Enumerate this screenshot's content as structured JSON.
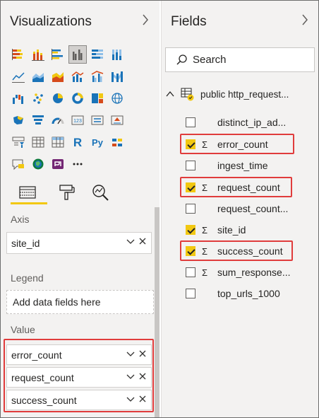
{
  "visualizations": {
    "title": "Visualizations",
    "collapse_icon": "chevron-right-icon",
    "gallery": [
      "stacked-bar-chart-icon",
      "stacked-column-chart-icon",
      "clustered-bar-chart-icon",
      "clustered-column-chart-icon",
      "100-stacked-bar-chart-icon",
      "100-stacked-column-chart-icon",
      "",
      "line-chart-icon",
      "area-chart-icon",
      "stacked-area-chart-icon",
      "line-and-stacked-column-icon",
      "line-and-clustered-column-icon",
      "ribbon-chart-icon",
      "",
      "waterfall-chart-icon",
      "scatter-chart-icon",
      "pie-chart-icon",
      "donut-chart-icon",
      "treemap-icon",
      "map-icon",
      "",
      "filled-map-icon",
      "funnel-icon",
      "gauge-icon",
      "card-icon",
      "multi-row-card-icon",
      "kpi-icon",
      "",
      "slicer-icon",
      "table-icon",
      "matrix-icon",
      "r-visual-icon",
      "python-visual-icon",
      "key-influencers-icon",
      "",
      "qa-icon",
      "arcgis-map-icon",
      "power-apps-icon",
      "more-icon"
    ],
    "tools": [
      "fields-tab-icon",
      "format-paint-icon",
      "analytics-icon"
    ],
    "axis": {
      "label": "Axis",
      "field": "site_id"
    },
    "legend": {
      "label": "Legend",
      "placeholder": "Add data fields here"
    },
    "value": {
      "label": "Value",
      "fields": [
        "error_count",
        "request_count",
        "success_count"
      ]
    }
  },
  "fields": {
    "title": "Fields",
    "collapse_icon": "chevron-right-icon",
    "search_placeholder": "Search",
    "table_name": "public http_request...",
    "items": [
      {
        "name": "distinct_ip_ad...",
        "checked": false,
        "sigma": false
      },
      {
        "name": "error_count",
        "checked": true,
        "sigma": true
      },
      {
        "name": "ingest_time",
        "checked": false,
        "sigma": false
      },
      {
        "name": "request_count",
        "checked": true,
        "sigma": true
      },
      {
        "name": "request_count...",
        "checked": false,
        "sigma": false
      },
      {
        "name": "site_id",
        "checked": true,
        "sigma": true
      },
      {
        "name": "success_count",
        "checked": true,
        "sigma": true
      },
      {
        "name": "sum_response...",
        "checked": false,
        "sigma": true
      },
      {
        "name": "top_urls_1000",
        "checked": false,
        "sigma": false
      }
    ]
  },
  "sigma_symbol": "Σ",
  "colors": {
    "accent_yellow": "#f2c811",
    "highlight_red": "#e03c3c",
    "pane_bg": "#f3f2f1"
  }
}
